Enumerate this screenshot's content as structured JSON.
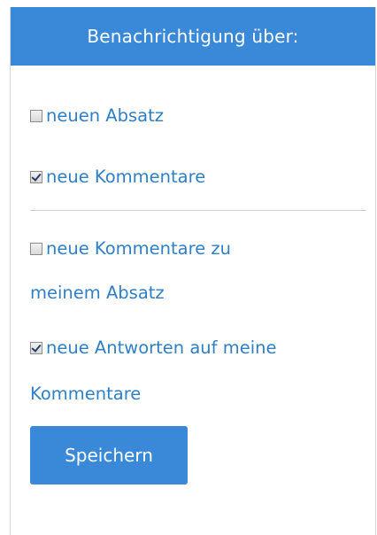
{
  "header": {
    "title": "Benachrichtigung über:"
  },
  "options": [
    {
      "label": "neuen Absatz",
      "checked": false
    },
    {
      "label": "neue Kommentare",
      "checked": true
    },
    {
      "label_line1": "neue Kommentare zu",
      "label_line2": "meinem Absatz",
      "checked": false
    },
    {
      "label_line1": "neue Antworten auf meine",
      "label_line2": "Kommentare",
      "checked": true
    }
  ],
  "actions": {
    "save_label": "Speichern"
  },
  "colors": {
    "accent": "#3a89d8",
    "link_text": "#2f7fc6"
  }
}
